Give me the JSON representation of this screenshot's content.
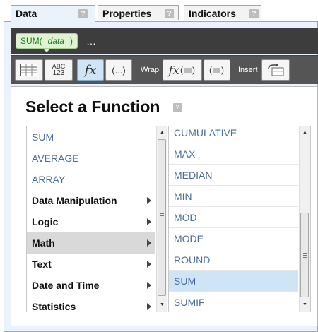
{
  "tabs": [
    {
      "label": "Data",
      "active": true
    },
    {
      "label": "Properties",
      "active": false
    },
    {
      "label": "Indicators",
      "active": false
    }
  ],
  "help_glyph": "?",
  "formula": {
    "func": "SUM(",
    "arg": "data",
    "close": ")",
    "more": "…"
  },
  "toolbar": {
    "table_label": "table-icon",
    "abc_top": "ABC",
    "abc_bottom": "123",
    "fx": "fx",
    "paren": "(...)",
    "wrap_label": "Wrap",
    "insert_label": "Insert"
  },
  "title": "Select a Function",
  "left_list": [
    {
      "label": "SUM",
      "kind": "fn"
    },
    {
      "label": "AVERAGE",
      "kind": "fn"
    },
    {
      "label": "ARRAY",
      "kind": "fn"
    },
    {
      "label": "Data Manipulation",
      "kind": "cat"
    },
    {
      "label": "Logic",
      "kind": "cat"
    },
    {
      "label": "Math",
      "kind": "cat",
      "selected": true
    },
    {
      "label": "Text",
      "kind": "cat"
    },
    {
      "label": "Date and Time",
      "kind": "cat"
    },
    {
      "label": "Statistics",
      "kind": "cat"
    }
  ],
  "right_list": [
    {
      "label": "CUMULATIVE"
    },
    {
      "label": "MAX"
    },
    {
      "label": "MEDIAN"
    },
    {
      "label": "MIN"
    },
    {
      "label": "MOD"
    },
    {
      "label": "MODE"
    },
    {
      "label": "ROUND"
    },
    {
      "label": "SUM",
      "selected": true
    },
    {
      "label": "SUMIF"
    }
  ],
  "colors": {
    "accent": "#cfe4f7",
    "function_text": "#4a6e9a",
    "formula_chip": "#dff3d2"
  }
}
